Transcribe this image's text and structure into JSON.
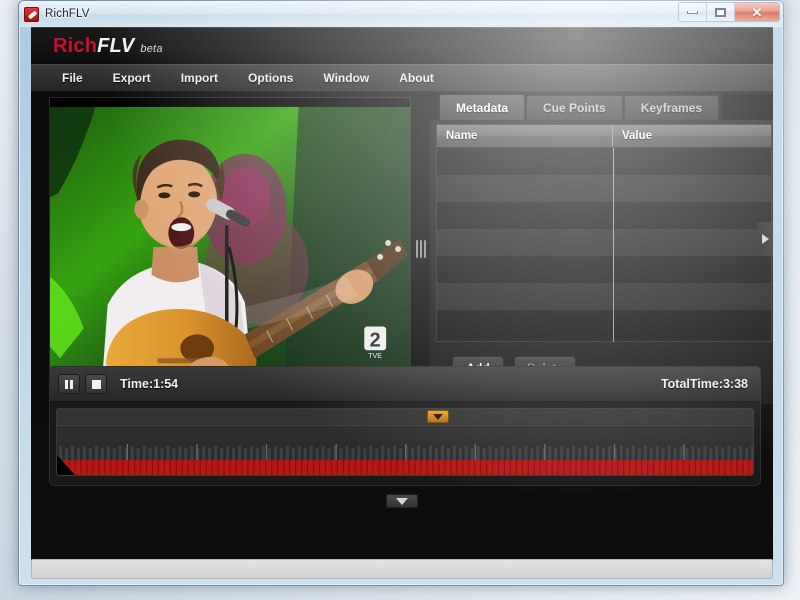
{
  "window": {
    "title": "RichFLV",
    "icon": "app-icon",
    "controls": {
      "minimize": "minimize-button",
      "maximize": "maximize-button",
      "close_glyph": "✕"
    }
  },
  "brand": {
    "rich": "Rich",
    "flv": "FLV",
    "beta": "beta"
  },
  "menu": {
    "items": [
      {
        "label": "File"
      },
      {
        "label": "Export"
      },
      {
        "label": "Import"
      },
      {
        "label": "Options"
      },
      {
        "label": "Window"
      },
      {
        "label": "About"
      }
    ]
  },
  "video": {
    "alt": "video-preview-frame",
    "channel_logo": "2",
    "channel_sub": "TVE"
  },
  "panel": {
    "tabs": [
      {
        "label": "Metadata",
        "active": true
      },
      {
        "label": "Cue Points",
        "active": false
      },
      {
        "label": "Keyframes",
        "active": false
      }
    ],
    "table": {
      "columns": [
        "Name",
        "Value"
      ],
      "rows": [
        {
          "name": "",
          "value": ""
        },
        {
          "name": "",
          "value": ""
        },
        {
          "name": "",
          "value": ""
        },
        {
          "name": "",
          "value": ""
        },
        {
          "name": "",
          "value": ""
        },
        {
          "name": "",
          "value": ""
        },
        {
          "name": "",
          "value": ""
        }
      ]
    },
    "buttons": {
      "add": "Add",
      "delete": "Delete"
    }
  },
  "player": {
    "pause": "pause-button",
    "stop": "stop-button",
    "time": "Time:1:54",
    "total_time": "TotalTime:3:38"
  },
  "colors": {
    "brand_red": "#c8102e",
    "waveform_red": "#b81717",
    "marker_orange": "#f0a12c",
    "panel_dark": "#151515"
  }
}
